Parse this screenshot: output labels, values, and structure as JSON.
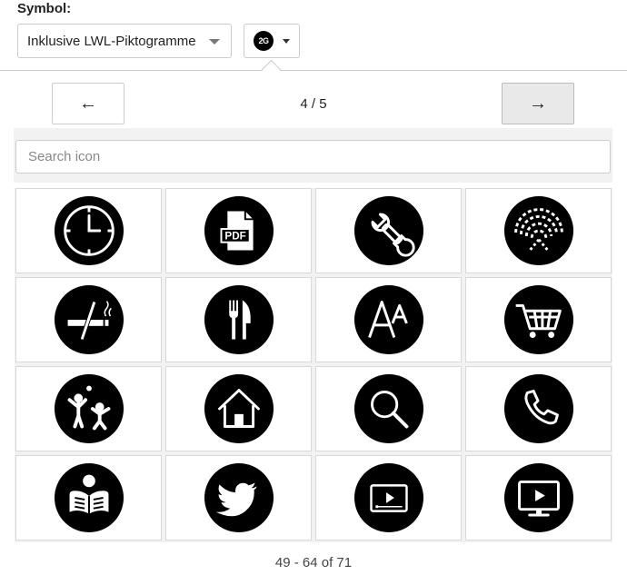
{
  "symbol": {
    "label": "Symbol:",
    "set_select": "Inklusive LWL-Piktogramme",
    "selected_icon_text": "2G"
  },
  "pager": {
    "prev_label": "←",
    "next_label": "→",
    "page_indicator": "4 / 5"
  },
  "search": {
    "placeholder": "Search icon",
    "value": ""
  },
  "icons": [
    "clock-icon",
    "pdf-document-icon",
    "wrench-icon",
    "wifi-signal-icon",
    "no-smoking-icon",
    "fork-knife-icon",
    "font-size-icon",
    "shopping-cart-icon",
    "children-playing-icon",
    "home-icon",
    "search-magnifier-icon",
    "phone-icon",
    "person-reading-icon",
    "twitter-bird-icon",
    "video-player-icon",
    "monitor-play-icon"
  ],
  "result_count": "49 - 64 of 71",
  "colors": {
    "icon_bg": "#000000",
    "icon_fg": "#ffffff",
    "panel_bg": "#f2f2f2"
  }
}
